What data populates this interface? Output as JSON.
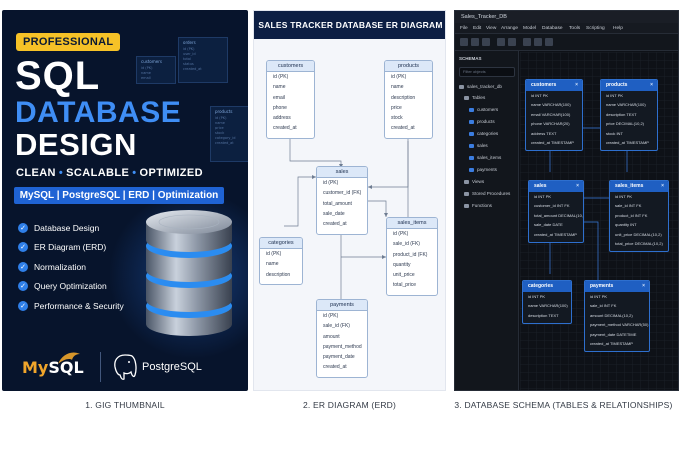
{
  "thumbnail": {
    "badge": "PROFESSIONAL",
    "title_line1": "SQL",
    "title_line2": "DATABASE",
    "title_line3": "DESIGN",
    "tagline": [
      "CLEAN",
      "SCALABLE",
      "OPTIMIZED"
    ],
    "tech_bar": "MySQL | PostgreSQL | ERD | Optimization",
    "features": [
      "Database Design",
      "ER Diagram (ERD)",
      "Normalization",
      "Query Optimization",
      "Performance & Security"
    ],
    "logo_mysql_a": "My",
    "logo_mysql_b": "SQL",
    "logo_postgres": "PostgreSQL",
    "accent": "#3f8ef5",
    "badge_color": "#f6c227",
    "background": "#07142c",
    "ghost_tables": [
      {
        "name": "orders",
        "fields": [
          "id (PK)",
          "user_id",
          "total",
          "status",
          "created_at"
        ]
      },
      {
        "name": "customers",
        "fields": [
          "id (PK)",
          "name",
          "email"
        ]
      },
      {
        "name": "products",
        "fields": [
          "id (PK)",
          "name",
          "price",
          "stock",
          "category_id",
          "created_at"
        ]
      }
    ]
  },
  "erd": {
    "header": "SALES TRACKER DATABASE ER DIAGRAM",
    "entities": {
      "customers": {
        "name": "customers",
        "fields": [
          "id (PK)",
          "name",
          "email",
          "phone",
          "address",
          "created_at"
        ]
      },
      "products": {
        "name": "products",
        "fields": [
          "id (PK)",
          "name",
          "description",
          "price",
          "stock",
          "created_at"
        ]
      },
      "sales": {
        "name": "sales",
        "fields": [
          "id (PK)",
          "customer_id (FK)",
          "total_amount",
          "sale_date",
          "created_at"
        ]
      },
      "categories": {
        "name": "categories",
        "fields": [
          "id (PK)",
          "name",
          "description"
        ]
      },
      "sales_items": {
        "name": "sales_items",
        "fields": [
          "id (PK)",
          "sale_id (FK)",
          "product_id (FK)",
          "quantity",
          "unit_price",
          "total_price"
        ]
      },
      "payments": {
        "name": "payments",
        "fields": [
          "id (PK)",
          "sale_id (FK)",
          "amount",
          "payment_method",
          "payment_date",
          "created_at"
        ]
      }
    }
  },
  "schema_tool": {
    "window_title": "Sales_Tracker_DB",
    "menu": [
      "File",
      "Edit",
      "View",
      "Arrange",
      "Model",
      "Database",
      "Tools",
      "Scripting",
      "Help"
    ],
    "sidebar": {
      "heading": "SCHEMAS",
      "filter_placeholder": "Filter objects",
      "db_name": "sales_tracker_db",
      "tables_label": "Tables",
      "tables": [
        "customers",
        "products",
        "categories",
        "sales",
        "sales_items",
        "payments"
      ],
      "views_label": "Views",
      "procedures_label": "Stored Procedures",
      "functions_label": "Functions"
    },
    "tables": {
      "customers": {
        "name": "customers",
        "fields": [
          "id INT PK",
          "name VARCHAR(100)",
          "email VARCHAR(100)",
          "phone VARCHAR(20)",
          "address TEXT",
          "created_at TIMESTAMP"
        ]
      },
      "products": {
        "name": "products",
        "fields": [
          "id INT PK",
          "name VARCHAR(100)",
          "description TEXT",
          "price DECIMAL(10,2)",
          "stock INT",
          "created_at TIMESTAMP"
        ]
      },
      "sales": {
        "name": "sales",
        "fields": [
          "id INT PK",
          "customer_id INT FK",
          "total_amount DECIMAL(10,2)",
          "sale_date DATE",
          "created_at TIMESTAMP"
        ]
      },
      "sales_items": {
        "name": "sales_items",
        "fields": [
          "id INT PK",
          "sale_id INT FK",
          "product_id INT FK",
          "quantity INT",
          "unit_price DECIMAL(10,2)",
          "total_price DECIMAL(10,2)"
        ]
      },
      "categories": {
        "name": "categories",
        "fields": [
          "id INT PK",
          "name VARCHAR(100)",
          "description TEXT"
        ]
      },
      "payments": {
        "name": "payments",
        "fields": [
          "id INT PK",
          "sale_id INT FK",
          "amount DECIMAL(10,2)",
          "payment_method VARCHAR(50)",
          "payment_date DATETIME",
          "created_at TIMESTAMP"
        ]
      }
    },
    "table_header_color": "#1f5fc2"
  },
  "captions": {
    "one": "1. GIG THUMBNAIL",
    "two": "2. ER DIAGRAM (ERD)",
    "three": "3. DATABASE SCHEMA (TABLES & RELATIONSHIPS)"
  }
}
